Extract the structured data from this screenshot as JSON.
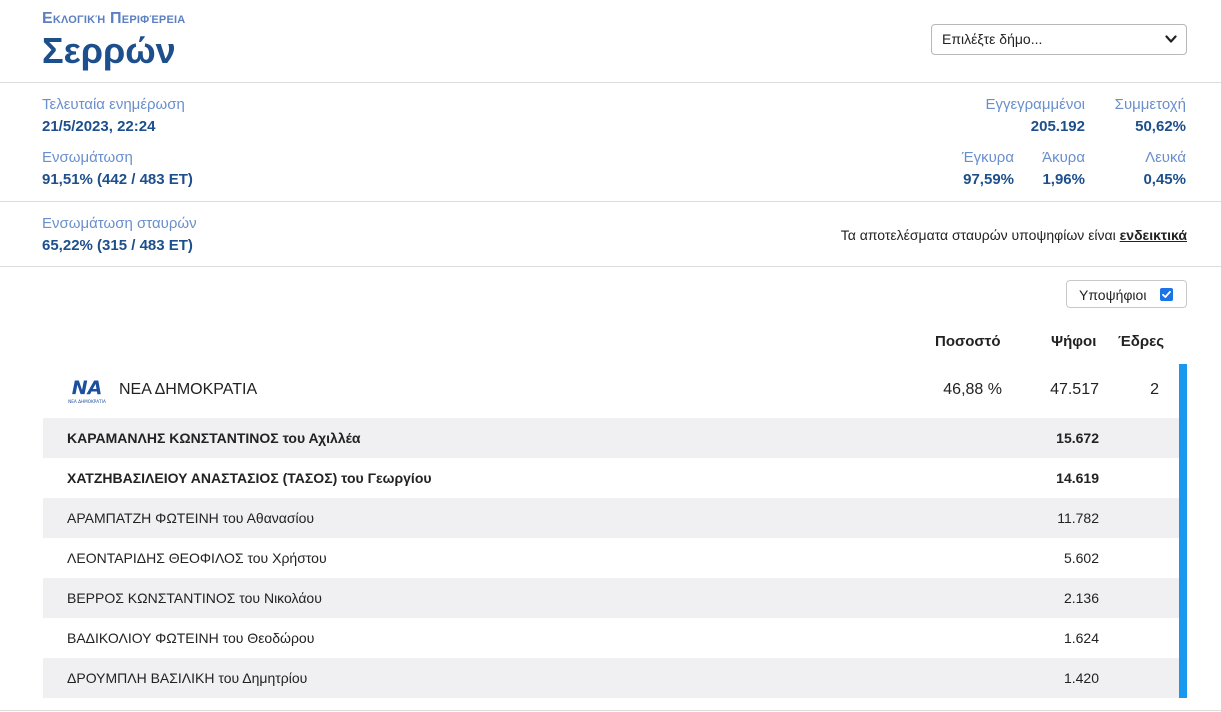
{
  "header": {
    "kicker": "Εκλογική Περιφέρεια",
    "title": "Σερρών",
    "select": {
      "selected": "Επιλέξτε δήμο..."
    }
  },
  "stats": {
    "last_update": {
      "label": "Τελευταία ενημέρωση",
      "value": "21/5/2023, 22:24"
    },
    "incorporation": {
      "label": "Ενσωμάτωση",
      "value": "91,51% (442 / 483 ΕΤ)"
    },
    "registered": {
      "label": "Εγγεγραμμένοι",
      "value": "205.192"
    },
    "turnout": {
      "label": "Συμμετοχή",
      "value": "50,62%"
    },
    "valid": {
      "label": "Έγκυρα",
      "value": "97,59%"
    },
    "invalid": {
      "label": "Άκυρα",
      "value": "1,96%"
    },
    "blank": {
      "label": "Λευκά",
      "value": "0,45%"
    },
    "cross_incorporation": {
      "label": "Ενσωμάτωση σταυρών",
      "value": "65,22% (315 / 483 ΕΤ)"
    },
    "note_text": "Τα αποτελέσματα σταυρών υποψηφίων είναι ",
    "note_link": "ενδεικτικά"
  },
  "toggle": {
    "label": "Υποψήφιοι",
    "checked": true
  },
  "table": {
    "headers": {
      "pct": "Ποσοστό",
      "votes": "Ψήφοι",
      "seats": "Έδρες"
    },
    "party": {
      "logo_text": "ΝΑ",
      "logo_sub": "ΝΕΑ ΔΗΜΟΚΡΑΤΙΑ",
      "name": "ΝΕΑ ΔΗΜΟΚΡΑΤΙΑ",
      "pct": "46,88 %",
      "votes": "47.517",
      "seats": "2",
      "accent_color": "#1a97ee"
    },
    "candidates": [
      {
        "name": "ΚΑΡΑΜΑΝΛΗΣ ΚΩΝΣΤΑΝΤΙΝΟΣ του Αχιλλέα",
        "votes": "15.672",
        "elected": true
      },
      {
        "name": "ΧΑΤΖΗΒΑΣΙΛΕΙΟΥ ΑΝΑΣΤΑΣΙΟΣ (ΤΑΣΟΣ) του Γεωργίου",
        "votes": "14.619",
        "elected": true
      },
      {
        "name": "ΑΡΑΜΠΑΤΖΗ ΦΩΤΕΙΝΗ του Αθανασίου",
        "votes": "11.782",
        "elected": false
      },
      {
        "name": "ΛΕΟΝΤΑΡΙΔΗΣ ΘΕΟΦΙΛΟΣ του Χρήστου",
        "votes": "5.602",
        "elected": false
      },
      {
        "name": "ΒΕΡΡΟΣ ΚΩΝΣΤΑΝΤΙΝΟΣ του Νικολάου",
        "votes": "2.136",
        "elected": false
      },
      {
        "name": "ΒΑΔΙΚΟΛΙΟΥ ΦΩΤΕΙΝΗ του Θεοδώρου",
        "votes": "1.624",
        "elected": false
      },
      {
        "name": "ΔΡΟΥΜΠΛΗ ΒΑΣΙΛΙΚΗ του Δημητρίου",
        "votes": "1.420",
        "elected": false
      }
    ]
  }
}
